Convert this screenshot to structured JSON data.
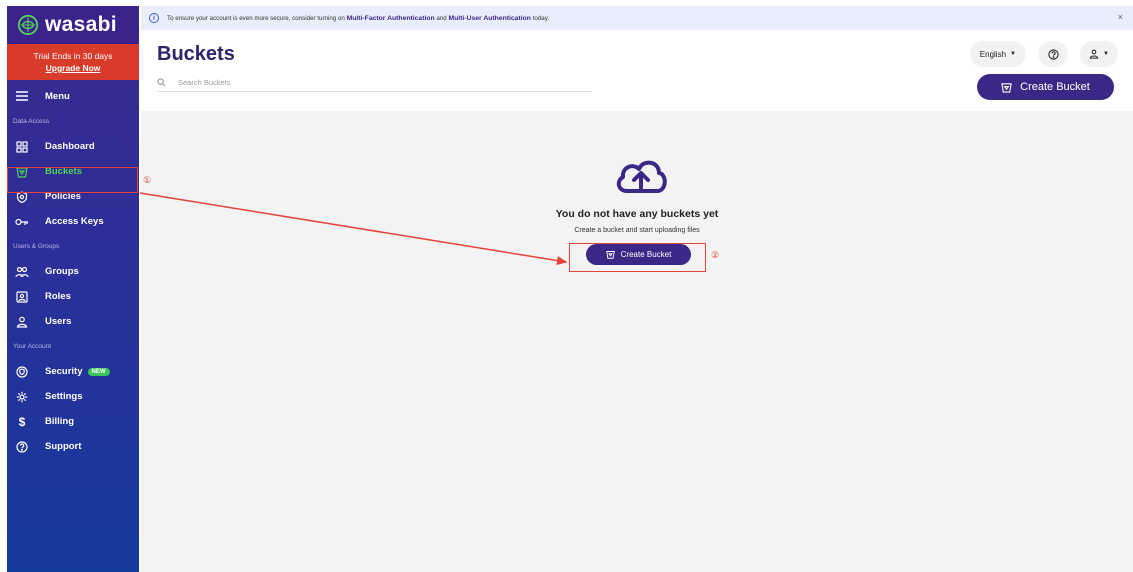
{
  "sidebar": {
    "logo_text": "wasabi",
    "trial_text": "Trial Ends in 30 days",
    "upgrade_label": "Upgrade Now",
    "menu_label": "Menu",
    "section_data_access": "Data Access",
    "section_users_groups": "Users & Groups",
    "section_your_account": "Your Account",
    "items": {
      "dashboard": "Dashboard",
      "buckets": "Buckets",
      "policies": "Policies",
      "access_keys": "Access Keys",
      "groups": "Groups",
      "roles": "Roles",
      "users": "Users",
      "security": "Security",
      "security_badge": "NEW",
      "settings": "Settings",
      "billing": "Billing",
      "support": "Support"
    },
    "active_item": "buckets",
    "accent_color": "#4fd15b"
  },
  "banner": {
    "text_before": "To ensure your account is even more secure, consider turning on",
    "mfa_link": "Multi-Factor Authentication",
    "text_and": "and",
    "mua_link": "Multi-User Authentication",
    "text_after": "today.",
    "close_label": "×"
  },
  "header": {
    "title": "Buckets",
    "search_placeholder": "Search Buckets",
    "language": "English",
    "create_bucket_label": "Create Bucket"
  },
  "empty_state": {
    "title": "You do not have any buckets yet",
    "subtitle": "Create a bucket and start uploading files",
    "create_bucket_label": "Create Bucket"
  },
  "annotations": {
    "step1": "①",
    "step2": "②",
    "color": "#e2433a"
  },
  "colors": {
    "brand_purple": "#3b2886",
    "trial_red": "#d93b2b"
  }
}
